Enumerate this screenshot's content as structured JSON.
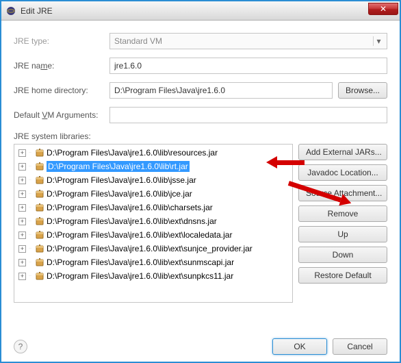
{
  "window": {
    "title": "Edit JRE",
    "close_glyph": "✕"
  },
  "form": {
    "type_label": "JRE type:",
    "type_value": "Standard VM",
    "name_label": "JRE name:",
    "name_value": "jre1.6.0",
    "home_label": "JRE home directory:",
    "home_value": "D:\\Program Files\\Java\\jre1.6.0",
    "browse_label": "Browse...",
    "vmargs_label": "Default VM Arguments:",
    "vmargs_value": ""
  },
  "libs": {
    "section_label": "JRE system libraries:",
    "items": [
      "D:\\Program Files\\Java\\jre1.6.0\\lib\\resources.jar",
      "D:\\Program Files\\Java\\jre1.6.0\\lib\\rt.jar",
      "D:\\Program Files\\Java\\jre1.6.0\\lib\\jsse.jar",
      "D:\\Program Files\\Java\\jre1.6.0\\lib\\jce.jar",
      "D:\\Program Files\\Java\\jre1.6.0\\lib\\charsets.jar",
      "D:\\Program Files\\Java\\jre1.6.0\\lib\\ext\\dnsns.jar",
      "D:\\Program Files\\Java\\jre1.6.0\\lib\\ext\\localedata.jar",
      "D:\\Program Files\\Java\\jre1.6.0\\lib\\ext\\sunjce_provider.jar",
      "D:\\Program Files\\Java\\jre1.6.0\\lib\\ext\\sunmscapi.jar",
      "D:\\Program Files\\Java\\jre1.6.0\\lib\\ext\\sunpkcs11.jar"
    ],
    "selected_index": 1
  },
  "buttons": {
    "add_external": "Add External JARs...",
    "javadoc": "Javadoc Location...",
    "source": "Source Attachment...",
    "remove": "Remove",
    "up": "Up",
    "down": "Down",
    "restore": "Restore Default"
  },
  "footer": {
    "help_glyph": "?",
    "ok": "OK",
    "cancel": "Cancel"
  }
}
